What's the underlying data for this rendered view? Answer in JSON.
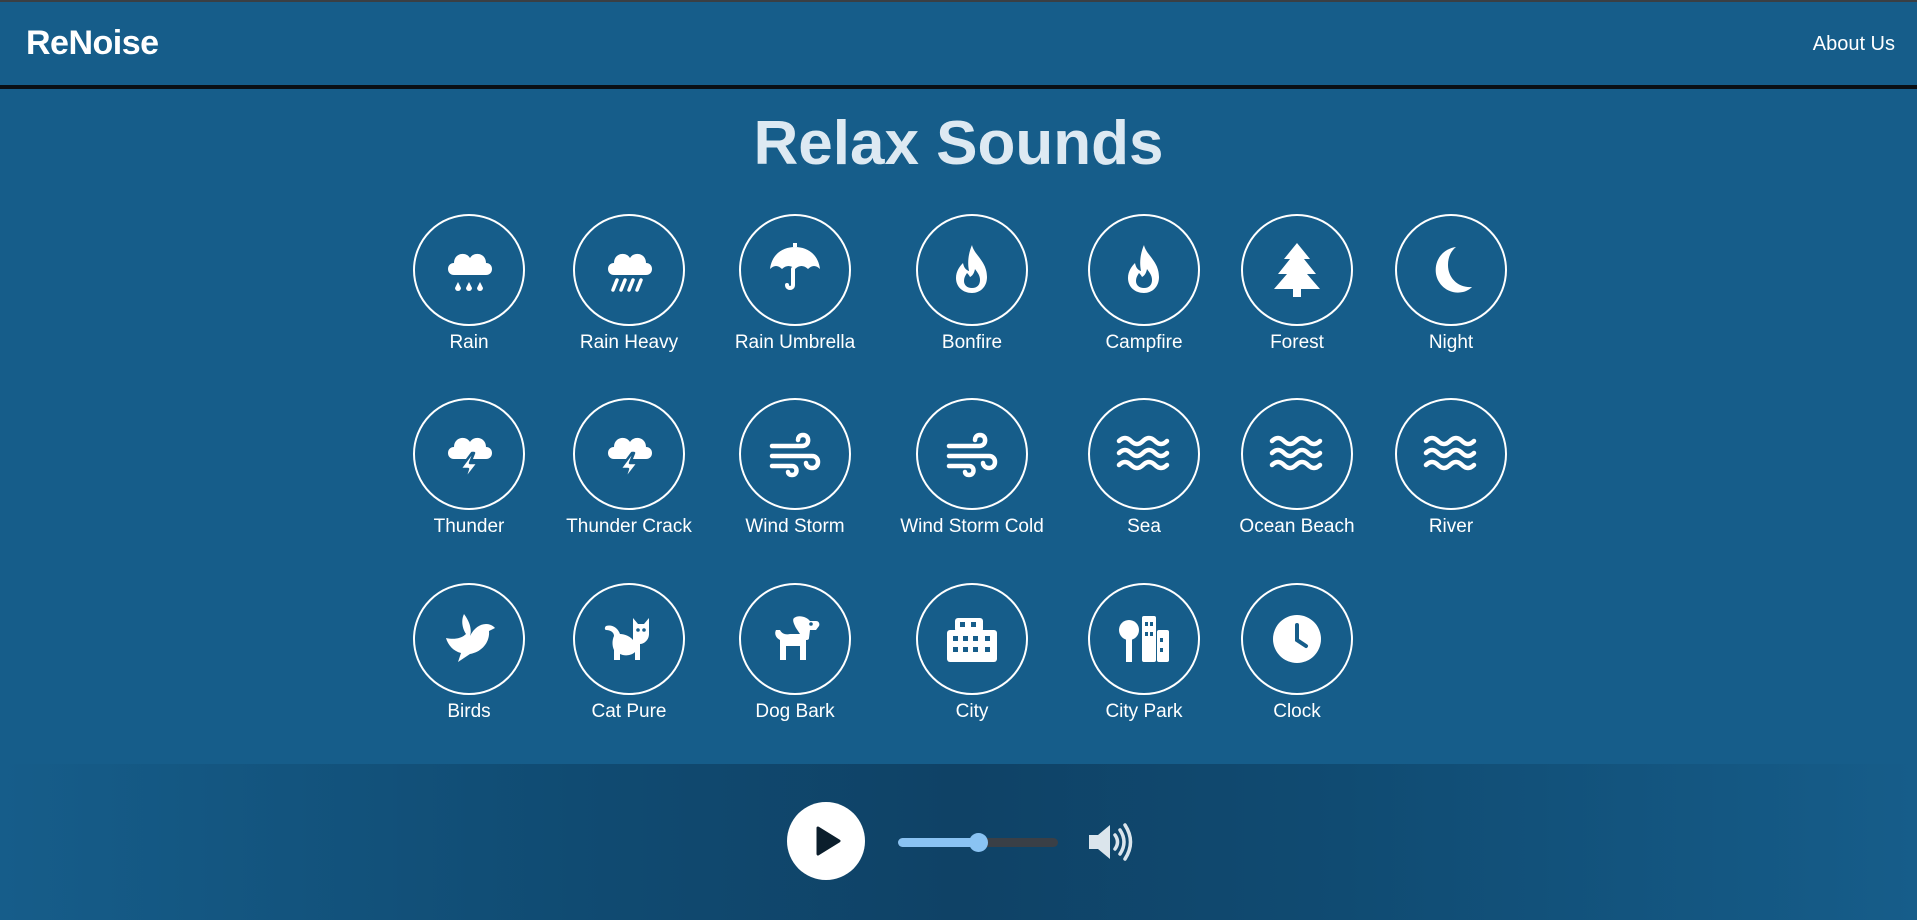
{
  "navbar": {
    "brand": "ReNoise",
    "about": "About Us"
  },
  "title": "Relax Sounds",
  "sounds": [
    {
      "label": "Rain",
      "icon": "rain-icon"
    },
    {
      "label": "Rain Heavy",
      "icon": "heavy-rain-icon"
    },
    {
      "label": "Rain Umbrella",
      "icon": "umbrella-icon"
    },
    {
      "label": "Bonfire",
      "icon": "fire-icon"
    },
    {
      "label": "Campfire",
      "icon": "fire-icon"
    },
    {
      "label": "Forest",
      "icon": "tree-icon"
    },
    {
      "label": "Night",
      "icon": "moon-icon"
    },
    {
      "label": "Thunder",
      "icon": "thunderstorm-icon"
    },
    {
      "label": "Thunder Crack",
      "icon": "thunderstorm-icon"
    },
    {
      "label": "Wind Storm",
      "icon": "wind-icon"
    },
    {
      "label": "Wind Storm Cold",
      "icon": "wind-icon"
    },
    {
      "label": "Sea",
      "icon": "water-icon"
    },
    {
      "label": "Ocean Beach",
      "icon": "water-icon"
    },
    {
      "label": "River",
      "icon": "water-icon"
    },
    {
      "label": "Birds",
      "icon": "dove-icon"
    },
    {
      "label": "Cat Pure",
      "icon": "cat-icon"
    },
    {
      "label": "Dog Bark",
      "icon": "dog-icon"
    },
    {
      "label": "City",
      "icon": "city-icon"
    },
    {
      "label": "City Park",
      "icon": "tree-city-icon"
    },
    {
      "label": "Clock",
      "icon": "clock-icon"
    }
  ],
  "player": {
    "play_icon": "play-icon",
    "volume_icon": "volume-high-icon",
    "volume_level": 0.5,
    "accent_color": "#8ac3f3"
  }
}
